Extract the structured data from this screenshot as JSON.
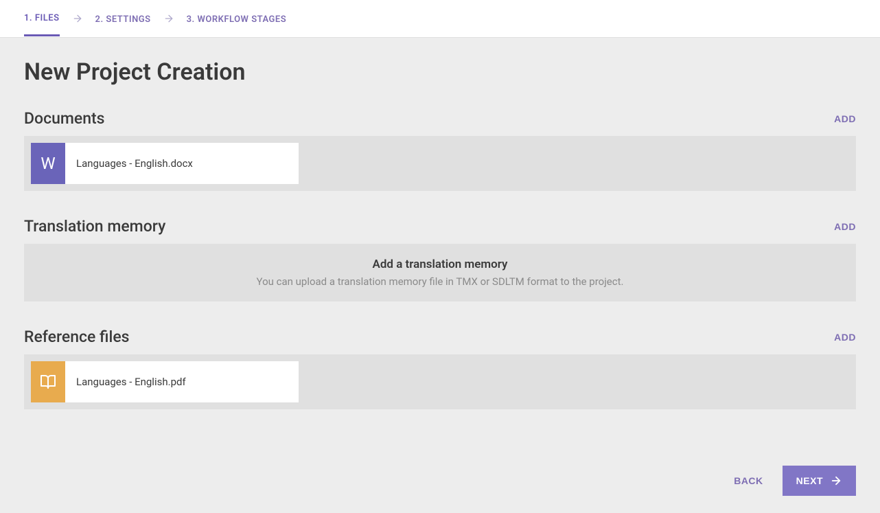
{
  "nav": {
    "steps": [
      {
        "label": "1. FILES",
        "active": true
      },
      {
        "label": "2. SETTINGS",
        "active": false
      },
      {
        "label": "3. WORKFLOW STAGES",
        "active": false
      }
    ]
  },
  "page": {
    "title": "New Project Creation"
  },
  "documents": {
    "title": "Documents",
    "add_label": "ADD",
    "items": [
      {
        "name": "Languages - English.docx",
        "icon_letter": "W",
        "icon_type": "word"
      }
    ]
  },
  "translation_memory": {
    "title": "Translation memory",
    "add_label": "ADD",
    "empty_title": "Add a translation memory",
    "empty_desc": "You can upload a translation memory file in TMX or SDLTM format to the project."
  },
  "reference_files": {
    "title": "Reference files",
    "add_label": "ADD",
    "items": [
      {
        "name": "Languages - English.pdf",
        "icon_type": "pdf"
      }
    ]
  },
  "footer": {
    "back_label": "BACK",
    "next_label": "NEXT"
  }
}
